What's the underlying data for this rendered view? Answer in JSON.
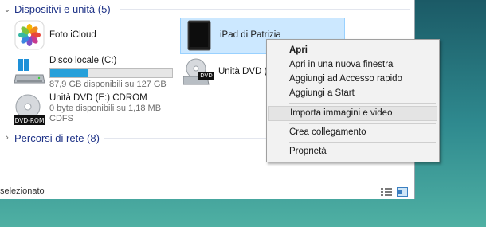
{
  "groups": {
    "devices": "Dispositivi e unità (5)",
    "network": "Percorsi di rete (8)"
  },
  "items": {
    "icloud": {
      "name": "Foto iCloud",
      "icon": "icloud-photos-icon"
    },
    "ipad": {
      "name": "iPad di Patrizia",
      "icon": "ipad-icon"
    },
    "local_disk": {
      "name": "Disco locale (C:)",
      "free": "87,9 GB disponibili su 127 GB",
      "used_fraction": 0.31,
      "icon": "windows-drive-icon"
    },
    "dvd_d": {
      "name": "Unità DVD (D:)",
      "badge": "DVD",
      "icon": "dvd-drive-icon"
    },
    "dvd_e": {
      "name": "Unità DVD (E:) CDROM",
      "free": "0 byte disponibili su 1,18 MB",
      "fs": "CDFS",
      "badge": "DVD-ROM",
      "icon": "dvd-rom-icon"
    }
  },
  "status": {
    "text": "selezionato"
  },
  "context_menu": {
    "open": "Apri",
    "open_new_window": "Apri in una nuova finestra",
    "quick_access": "Aggiungi ad Accesso rapido",
    "start": "Aggiungi a Start",
    "import": "Importa immagini e video",
    "shortcut": "Crea collegamento",
    "properties": "Proprietà"
  },
  "colors": {
    "accent": "#26a0da",
    "selection": "#cce8ff",
    "header_text": "#1e3287"
  }
}
